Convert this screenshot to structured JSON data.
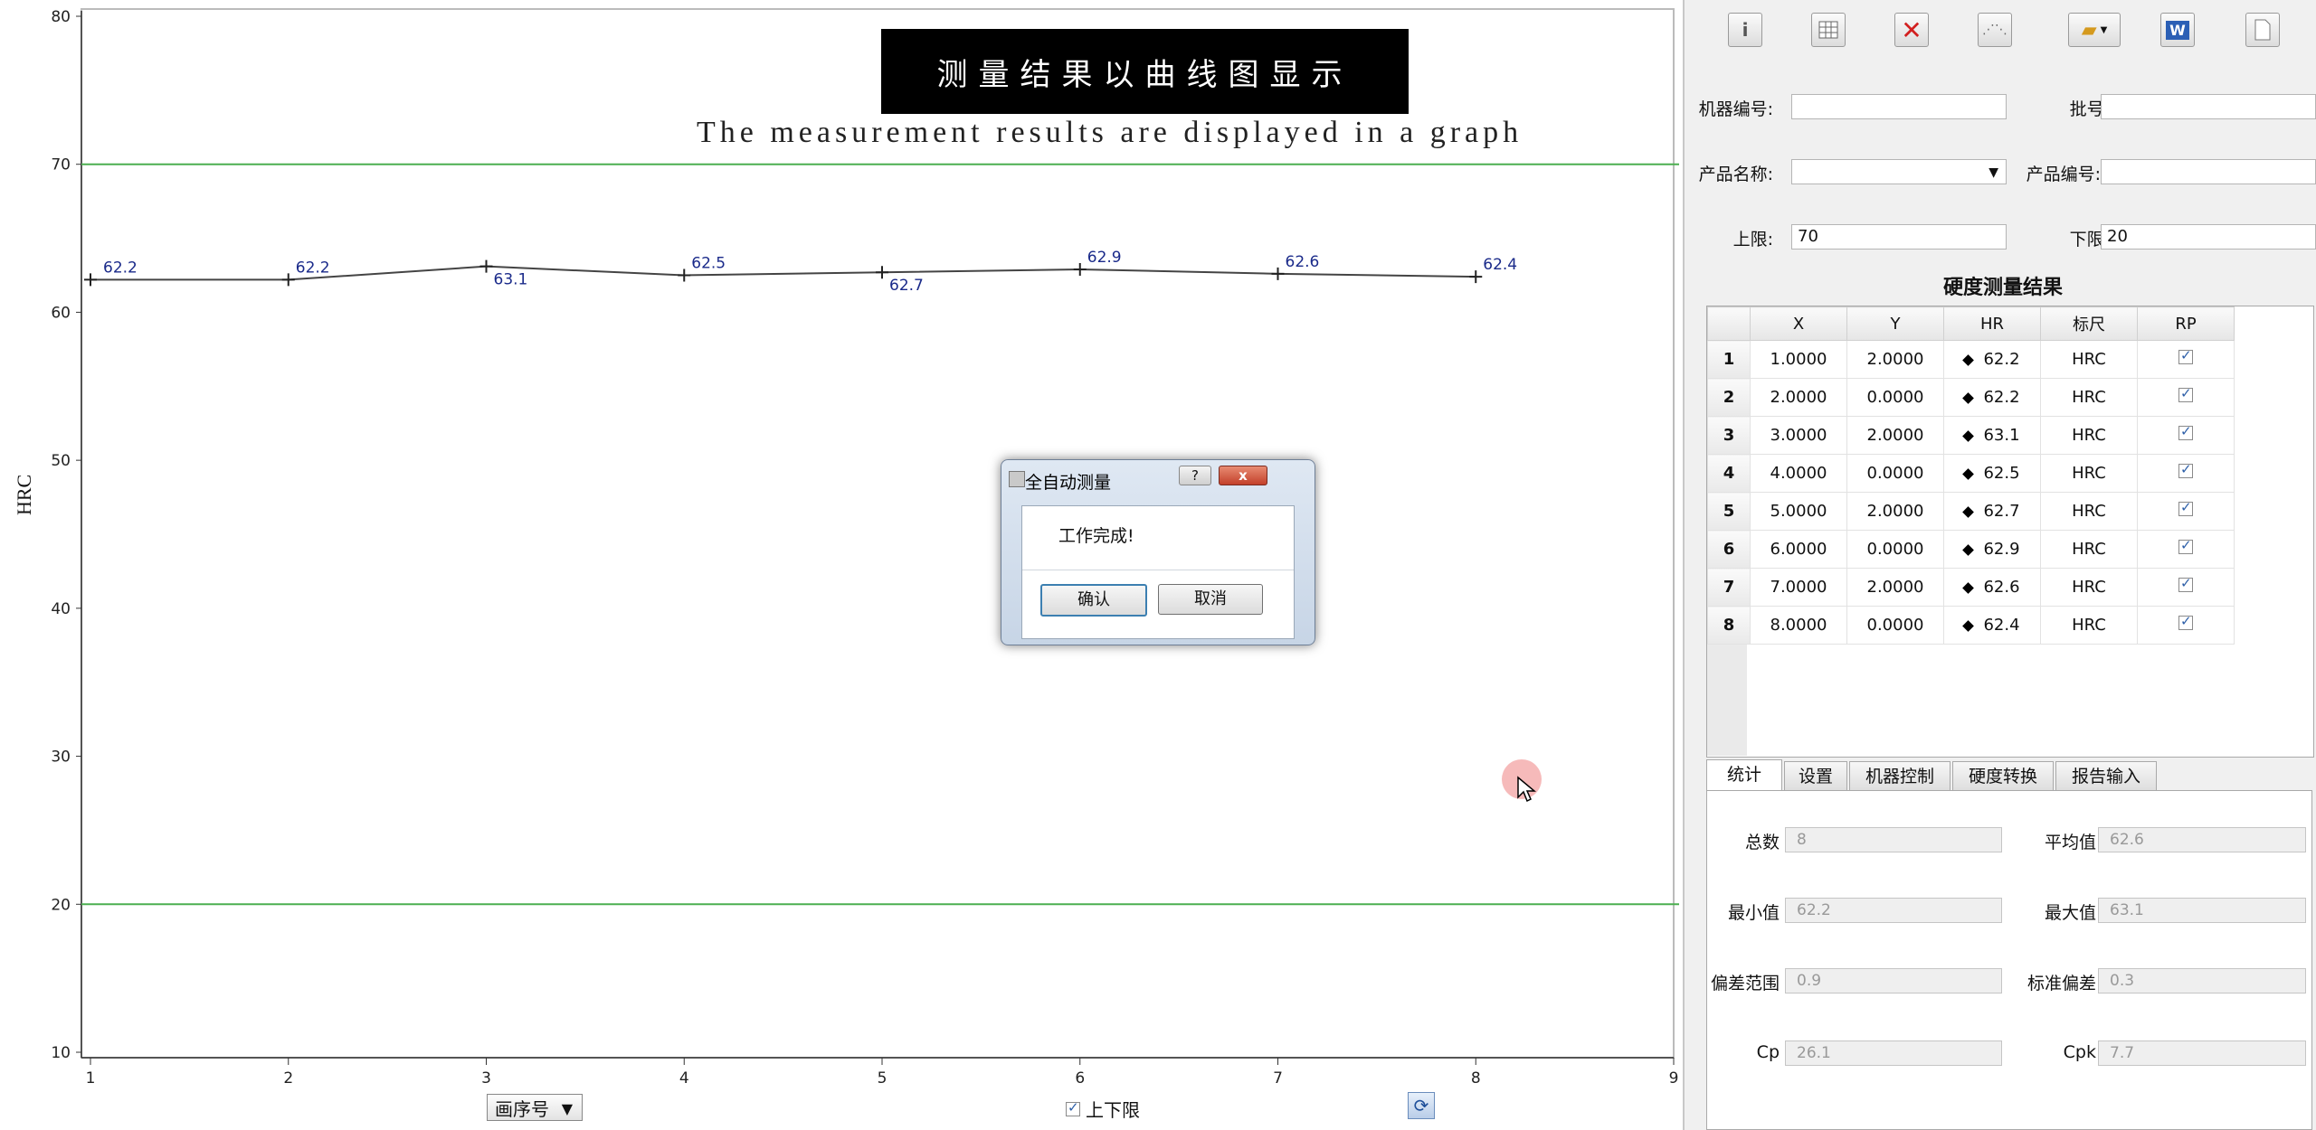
{
  "chart": {
    "title": "测量结果以曲线图显示",
    "subtitle": "The measurement results are displayed in a graph",
    "y_axis_label": "HRC",
    "x_mode_select": "画序号",
    "limit_checkbox_label": "上下限",
    "limit_checked": true
  },
  "chart_data": {
    "type": "line",
    "title": "测量结果以曲线图显示",
    "ylabel": "HRC",
    "xlabel": "",
    "x": [
      1,
      2,
      3,
      4,
      5,
      6,
      7,
      8
    ],
    "values": [
      62.2,
      62.2,
      63.1,
      62.5,
      62.7,
      62.9,
      62.6,
      62.4
    ],
    "xlim": [
      1,
      9
    ],
    "ylim": [
      10,
      80
    ],
    "x_ticks": [
      "1",
      "2",
      "3",
      "4",
      "5",
      "6",
      "7",
      "8",
      "9"
    ],
    "y_ticks": [
      "10",
      "20",
      "30",
      "40",
      "50",
      "60",
      "70",
      "80"
    ],
    "upper_limit": 70,
    "lower_limit": 20,
    "limit_color": "#4caf50",
    "line_color": "#444444",
    "label_color": "#1a2a8a"
  },
  "dialog": {
    "title": "全自动测量",
    "message": "工作完成!",
    "ok_label": "确认",
    "cancel_label": "取消",
    "help_label": "?",
    "close_label": "x"
  },
  "toolbar": {
    "icons": [
      "info-icon",
      "table-icon",
      "delete-icon",
      "scatter-icon",
      "open-folder-icon",
      "word-export-icon",
      "new-document-icon"
    ]
  },
  "form": {
    "machine_no_label": "机器编号:",
    "machine_no_value": "",
    "batch_label": "批号:",
    "batch_value": "",
    "product_name_label": "产品名称:",
    "product_name_value": "",
    "product_no_label": "产品编号:",
    "product_no_value": "",
    "upper_label": "上限:",
    "upper_value": "70",
    "lower_label": "下限:",
    "lower_value": "20"
  },
  "results": {
    "title": "硬度测量结果",
    "columns": [
      "X",
      "Y",
      "HR",
      "标尺",
      "RP"
    ],
    "rows": [
      {
        "n": "1",
        "x": "1.0000",
        "y": "2.0000",
        "hr": "62.2",
        "scale": "HRC"
      },
      {
        "n": "2",
        "x": "2.0000",
        "y": "0.0000",
        "hr": "62.2",
        "scale": "HRC"
      },
      {
        "n": "3",
        "x": "3.0000",
        "y": "2.0000",
        "hr": "63.1",
        "scale": "HRC"
      },
      {
        "n": "4",
        "x": "4.0000",
        "y": "0.0000",
        "hr": "62.5",
        "scale": "HRC"
      },
      {
        "n": "5",
        "x": "5.0000",
        "y": "2.0000",
        "hr": "62.7",
        "scale": "HRC"
      },
      {
        "n": "6",
        "x": "6.0000",
        "y": "0.0000",
        "hr": "62.9",
        "scale": "HRC"
      },
      {
        "n": "7",
        "x": "7.0000",
        "y": "2.0000",
        "hr": "62.6",
        "scale": "HRC"
      },
      {
        "n": "8",
        "x": "8.0000",
        "y": "0.0000",
        "hr": "62.4",
        "scale": "HRC"
      }
    ]
  },
  "tabs": [
    "统计",
    "设置",
    "机器控制",
    "硬度转换",
    "报告输入"
  ],
  "stats": {
    "total_label": "总数",
    "total": "8",
    "mean_label": "平均值",
    "mean": "62.6",
    "min_label": "最小值",
    "min": "62.2",
    "max_label": "最大值",
    "max": "63.1",
    "range_label": "偏差范围",
    "range": "0.9",
    "std_label": "标准偏差",
    "std": "0.3",
    "cp_label": "Cp",
    "cp": "26.1",
    "cpk_label": "Cpk",
    "cpk": "7.7"
  }
}
